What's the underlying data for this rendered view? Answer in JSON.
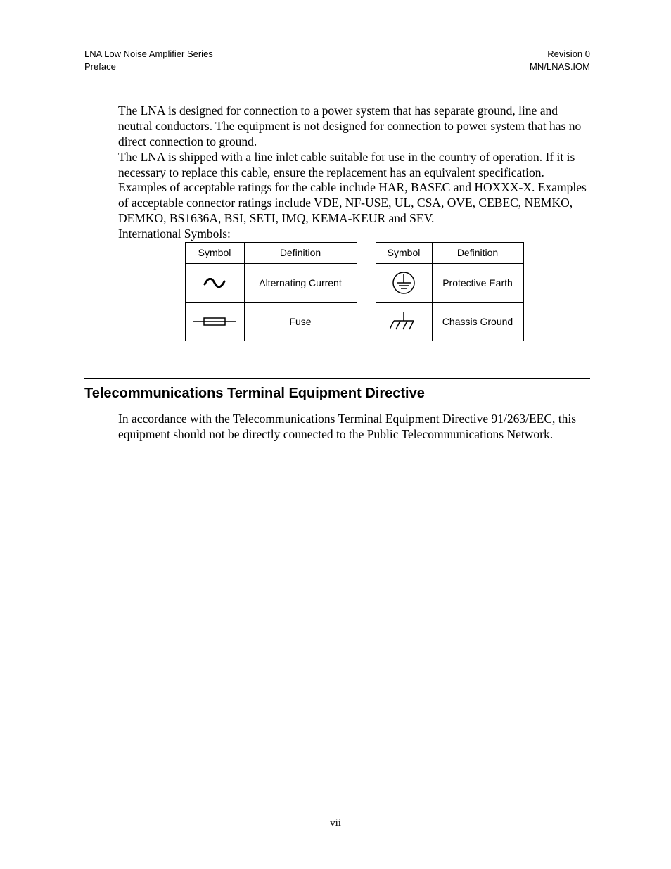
{
  "header": {
    "left_line1": "LNA Low Noise Amplifier Series",
    "left_line2": "Preface",
    "right_line1": "Revision 0",
    "right_line2": "MN/LNAS.IOM"
  },
  "paragraphs": {
    "p1": "The LNA is designed for connection to a power system that has separate ground, line and neutral conductors. The equipment is not designed for connection to power system that has no direct connection to ground.",
    "p2": "The LNA is shipped with a line inlet cable suitable for use in the country of operation. If it is necessary to replace this cable, ensure the replacement has an equivalent specification. Examples of acceptable ratings for the cable include HAR, BASEC and HOXXX-X. Examples of acceptable connector ratings include VDE, NF-USE, UL, CSA, OVE, CEBEC, NEMKO, DEMKO, BS1636A, BSI, SETI, IMQ, KEMA-KEUR and SEV.",
    "intl_label": "International Symbols:"
  },
  "symbols_table": {
    "headers": {
      "symbol": "Symbol",
      "definition": "Definition"
    },
    "left": [
      {
        "icon": "ac-icon",
        "definition": "Alternating Current"
      },
      {
        "icon": "fuse-icon",
        "definition": "Fuse"
      }
    ],
    "right": [
      {
        "icon": "protective-earth-icon",
        "definition": "Protective Earth"
      },
      {
        "icon": "chassis-ground-icon",
        "definition": "Chassis Ground"
      }
    ]
  },
  "section": {
    "heading": "Telecommunications Terminal Equipment Directive",
    "body": "In accordance with the Telecommunications Terminal Equipment Directive 91/263/EEC, this equipment should not be directly connected to the Public Telecommunications Network."
  },
  "page_number": "vii"
}
